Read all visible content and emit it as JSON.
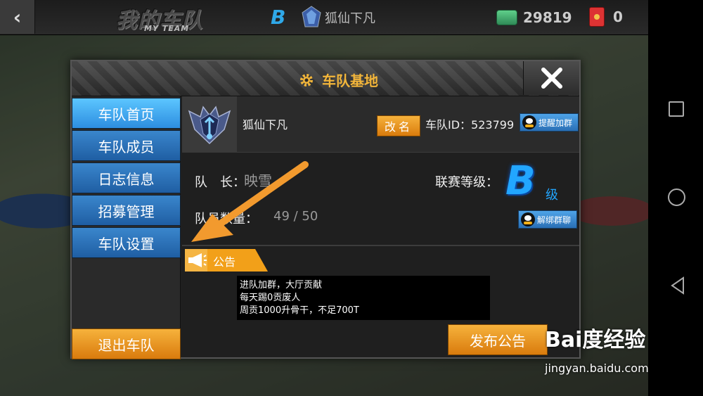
{
  "topbar": {
    "game_logo": "我的车队",
    "game_logo_sub": "MY TEAM",
    "rank_letter": "B",
    "team_name": "狐仙下凡",
    "currency_value": "29819",
    "redpack_value": "0"
  },
  "dialog": {
    "title": "车队基地",
    "tabs": [
      {
        "label": "车队首页"
      },
      {
        "label": "车队成员"
      },
      {
        "label": "日志信息"
      },
      {
        "label": "招募管理"
      },
      {
        "label": "车队设置"
      }
    ],
    "quit_label": "退出车队"
  },
  "team": {
    "name": "狐仙下凡",
    "rename_label": "改名",
    "id_label": "车队ID：523799",
    "join_group_label": "提醒加群",
    "captain_label": "队　长：",
    "captain_name": "映雪",
    "league_label": "联赛等级：",
    "league_grade": "B",
    "league_suffix": "级",
    "members_label": "队员数量：",
    "members_value": "49 / 50",
    "unbind_group_label": "解绑群聊"
  },
  "notice": {
    "tag_label": "公告",
    "lines": [
      "进队加群，大厅贡献",
      "每天踢0贡废人",
      "周贡1000升骨干，不足700T"
    ],
    "publish_label": "发布公告"
  },
  "watermark": {
    "brand": "Bai度经验",
    "url": "jingyan.baidu.com"
  },
  "colors": {
    "accent_orange": "#f6b23c",
    "tab_blue": "#2d8ee0",
    "title_gold": "#f2b53a",
    "grade_blue": "#22a6ff"
  }
}
